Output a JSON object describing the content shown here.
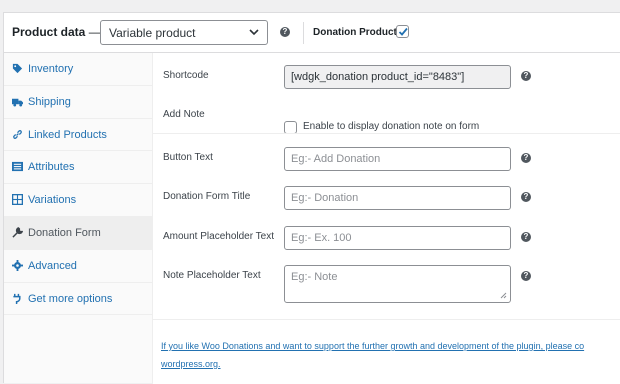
{
  "header": {
    "title": "Product data",
    "dash": "—",
    "product_type": "Variable product",
    "donation_label": "Donation Product:",
    "donation_checked": true
  },
  "sidebar": {
    "items": [
      {
        "label": "Inventory",
        "icon": "tag-icon"
      },
      {
        "label": "Shipping",
        "icon": "truck-icon"
      },
      {
        "label": "Linked Products",
        "icon": "link-icon"
      },
      {
        "label": "Attributes",
        "icon": "list-icon"
      },
      {
        "label": "Variations",
        "icon": "grid-icon"
      },
      {
        "label": "Donation Form",
        "icon": "wrench-icon",
        "active": true
      },
      {
        "label": "Advanced",
        "icon": "gear-icon"
      },
      {
        "label": "Get more options",
        "icon": "plugin-icon"
      }
    ]
  },
  "form": {
    "shortcode_label": "Shortcode",
    "shortcode_value": "[wdgk_donation product_id=\"8483\"]",
    "add_note_label": "Add Note",
    "add_note_text": "Enable to display donation note on form",
    "button_text_label": "Button Text",
    "button_text_placeholder": "Eg:- Add Donation",
    "form_title_label": "Donation Form Title",
    "form_title_placeholder": "Eg:- Donation",
    "amount_label": "Amount Placeholder Text",
    "amount_placeholder": "Eg:- Ex. 100",
    "note_label": "Note Placeholder Text",
    "note_placeholder": "Eg:- Note"
  },
  "footer": {
    "text": "If you like Woo Donations and want to support the further growth and development of the plugin, please co wordpress.org."
  },
  "colors": {
    "link": "#2271b1",
    "active_tab": "#eeeeee",
    "checkbox": "#2271b1"
  }
}
